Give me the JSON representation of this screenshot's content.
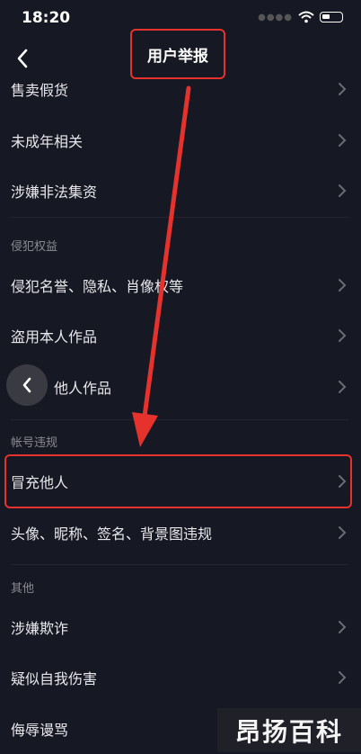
{
  "status_bar": {
    "time": "18:20"
  },
  "header": {
    "title": "用户举报"
  },
  "items": [
    {
      "label": "售卖假货"
    },
    {
      "label": "未成年相关"
    },
    {
      "label": "涉嫌非法集资"
    }
  ],
  "sections": [
    {
      "title": "侵犯权益",
      "items": [
        {
          "label": "侵犯名誉、隐私、肖像权等"
        },
        {
          "label": "盗用本人作品"
        },
        {
          "label": "他人作品"
        }
      ]
    },
    {
      "title": "帐号违规",
      "items": [
        {
          "label": "冒充他人"
        },
        {
          "label": "头像、昵称、签名、背景图违规"
        }
      ]
    },
    {
      "title": "其他",
      "items": [
        {
          "label": "涉嫌欺诈"
        },
        {
          "label": "疑似自我伤害"
        },
        {
          "label": "侮辱谩骂"
        }
      ]
    }
  ],
  "watermark": {
    "text": "昂扬百科"
  },
  "colors": {
    "background": "#161823",
    "annotation": "#e5322d",
    "chevron": "#6b6d75"
  }
}
